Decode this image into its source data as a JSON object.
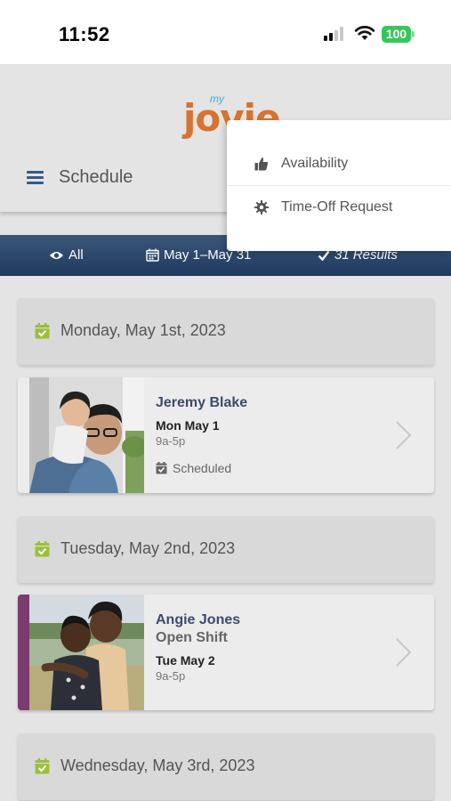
{
  "status_bar": {
    "time": "11:52",
    "battery": "100"
  },
  "header": {
    "logo_small": "my",
    "logo_main": "jovie",
    "title": "Schedule"
  },
  "filters": {
    "view": "All",
    "date_range": "May 1–May 31",
    "results": "31 Results"
  },
  "menu": {
    "items": [
      {
        "label": "Availability",
        "icon": "thumbs-up-icon"
      },
      {
        "label": "Time-Off Request",
        "icon": "gear-icon"
      }
    ]
  },
  "days": [
    {
      "date": "Monday, May 1st, 2023",
      "shift": {
        "name": "Jeremy Blake",
        "subtitle": "",
        "day": "Mon May 1",
        "time": "9a-5p",
        "status": "Scheduled",
        "accent": ""
      }
    },
    {
      "date": "Tuesday, May 2nd, 2023",
      "shift": {
        "name": "Angie Jones",
        "subtitle": "Open Shift",
        "day": "Tue May 2",
        "time": "9a-5p",
        "status": "",
        "accent": "#7a3b6e"
      }
    },
    {
      "date": "Wednesday, May 3rd, 2023"
    }
  ],
  "colors": {
    "brand_orange": "#d9722f",
    "brand_blue": "#3aaed8",
    "navy": "#1f3a5e",
    "calendar_green": "#9bbf3a",
    "battery_green": "#35c759"
  }
}
